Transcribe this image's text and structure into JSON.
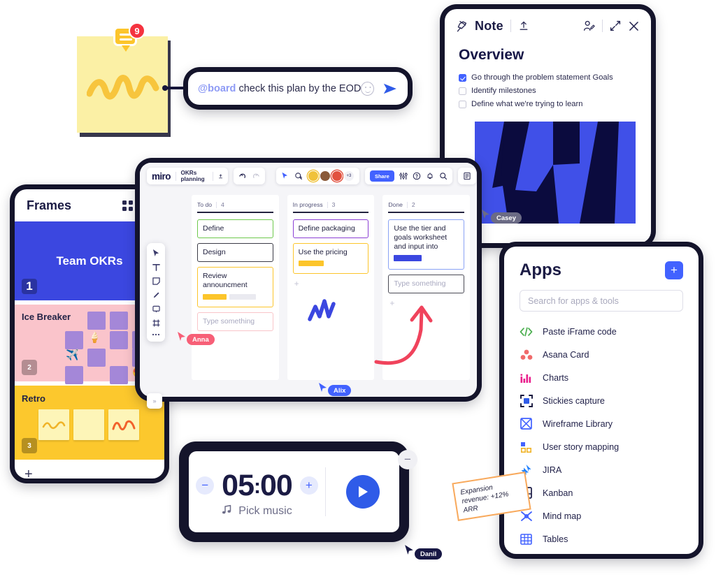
{
  "sticky_note": {
    "badge_count": "9",
    "icon": "comment-icon"
  },
  "comment_bar": {
    "mention": "@board",
    "text": " check this plan by the EOD",
    "emoji_icon": "smiley-icon",
    "send_icon": "send-icon"
  },
  "note_panel": {
    "title": "Note",
    "pin_icon": "pin-icon",
    "upload_icon": "upload-icon",
    "assign_icon": "assign-user-icon",
    "expand_icon": "expand-icon",
    "close_icon": "close-icon",
    "heading": "Overview",
    "checklist": [
      {
        "label": "Go through the problem statement Goals",
        "checked": true
      },
      {
        "label": "Identify milestones",
        "checked": false
      },
      {
        "label": "Define what we're trying to learn",
        "checked": false
      }
    ]
  },
  "frames_panel": {
    "title": "Frames",
    "grid_icon": "grid-view-icon",
    "list_icon": "list-view-icon",
    "add_label": "+",
    "frames": [
      {
        "number": "1",
        "title": "Team OKRs",
        "color": "#3b47e0"
      },
      {
        "number": "2",
        "title": "Ice Breaker",
        "color": "#fac4cb"
      },
      {
        "number": "3",
        "title": "Retro",
        "color": "#fcc82d"
      }
    ],
    "collapse_icon": "collapse-right-icon"
  },
  "board": {
    "logo": "miro",
    "name": "OKRs planning",
    "upload_icon": "upload-icon",
    "undo_icon": "undo-icon",
    "redo_icon": "redo-icon",
    "cursor_icon": "cursor-share-icon",
    "add_collaborator_icon": "add-collaborator-icon",
    "avatar_overflow": "+3",
    "share_label": "Share",
    "filter_icon": "filter-icon",
    "help_icon": "help-icon",
    "bell_icon": "bell-icon",
    "search_icon": "search-icon",
    "notes_icon": "notes-icon",
    "tools": [
      "select-icon",
      "text-icon",
      "sticky-note-icon",
      "pen-icon",
      "comment-icon",
      "frame-icon",
      "more-icon"
    ],
    "columns": [
      {
        "title": "To do",
        "count": "4",
        "cards": [
          {
            "text": "Define",
            "accent": "#6dc94c",
            "bars": []
          },
          {
            "text": "Design",
            "accent": "#3b3b46",
            "bars": []
          },
          {
            "text": "Review announcment",
            "accent": "#fcc52b",
            "bars": [
              "#fcc52b",
              "#e8e8ee"
            ]
          }
        ],
        "placeholder": "Type something",
        "placeholder_accent": "#f9c5c9"
      },
      {
        "title": "In progress",
        "count": "3",
        "cards": [
          {
            "text": "Define packaging",
            "accent": "#8b3fd4",
            "bars": []
          },
          {
            "text": "Use the pricing",
            "accent": "#fcc52b",
            "bars": [
              "#fcc52b"
            ]
          }
        ],
        "placeholder": "",
        "placeholder_accent": ""
      },
      {
        "title": "Done",
        "count": "2",
        "cards": [
          {
            "text": "Use the tier and goals worksheet and input into",
            "accent": "#8aa2f5",
            "bars": [
              "#3b47e0"
            ]
          }
        ],
        "placeholder": "Type something",
        "placeholder_accent": "#4a4a55"
      }
    ],
    "sticky_label": "Expansion revenue: +12% ARR",
    "cursors": [
      {
        "name": "Anna",
        "color": "#f75f77"
      },
      {
        "name": "Alix",
        "color": "#4262ff"
      },
      {
        "name": "Casey",
        "color": "#6b6b85"
      },
      {
        "name": "Danil",
        "color": "#181845"
      }
    ]
  },
  "apps_panel": {
    "title": "Apps",
    "add_icon": "plus-icon",
    "search_placeholder": "Search for apps & tools",
    "apps": [
      {
        "label": "Paste iFrame code",
        "icon": "code-icon",
        "color": "#4caf50"
      },
      {
        "label": "Asana Card",
        "icon": "asana-icon",
        "color": "#f06a6a"
      },
      {
        "label": "Charts",
        "icon": "charts-icon",
        "color": "#e91e8c"
      },
      {
        "label": "Stickies capture",
        "icon": "stickies-capture-icon",
        "color": "#2f5be8"
      },
      {
        "label": "Wireframe Library",
        "icon": "wireframe-icon",
        "color": "#4262ff"
      },
      {
        "label": "User story mapping",
        "icon": "user-story-icon",
        "color": "#f0b429"
      },
      {
        "label": "JIRA",
        "icon": "jira-icon",
        "color": "#2684ff"
      },
      {
        "label": "Kanban",
        "icon": "kanban-icon",
        "color": "#1b1b44"
      },
      {
        "label": "Mind map",
        "icon": "mindmap-icon",
        "color": "#4262ff"
      },
      {
        "label": "Tables",
        "icon": "tables-icon",
        "color": "#4262ff"
      }
    ]
  },
  "timer": {
    "minutes": "05",
    "separator": ":",
    "seconds": "00",
    "minus_label": "−",
    "plus_label": "+",
    "music_label": "Pick music",
    "music_icon": "music-note-icon",
    "play_icon": "play-icon",
    "collapse_label": "−"
  }
}
